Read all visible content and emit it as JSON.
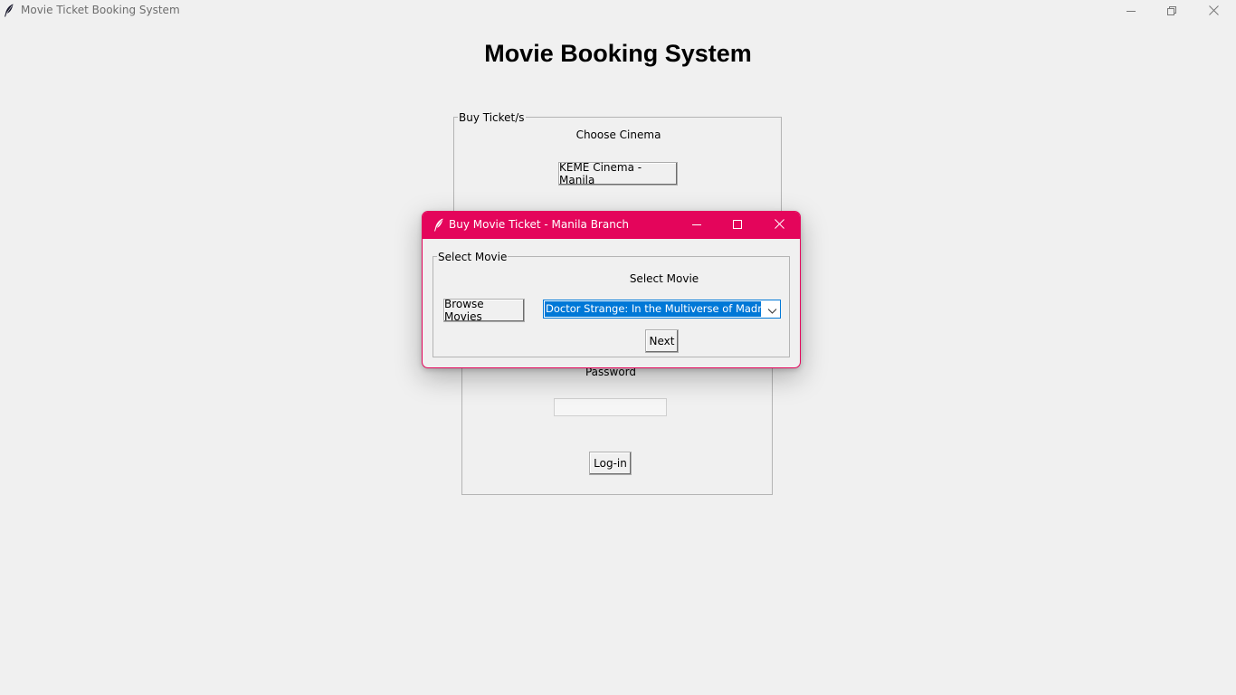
{
  "main_window": {
    "title": "Movie Ticket Booking System",
    "heading": "Movie Booking System"
  },
  "buy_frame": {
    "legend": "Buy Ticket/s",
    "choose_cinema_label": "Choose Cinema",
    "cinema_button_label": "KEME Cinema - Manila"
  },
  "login_frame": {
    "password_label": "Password",
    "password_value": "",
    "login_button_label": "Log-in"
  },
  "dialog": {
    "title": "Buy Movie Ticket - Manila Branch",
    "accent_color": "#e4055b",
    "select_frame_legend": "Select Movie",
    "select_movie_label": "Select Movie",
    "browse_button_label": "Browse Movies",
    "movie_selected": "Doctor Strange: In the Multiverse of Madness",
    "next_button_label": "Next"
  },
  "icons": {
    "app_icon": "feather-icon",
    "minimize": "minimize-icon",
    "maximize": "maximize-icon",
    "close": "close-icon",
    "dropdown": "chevron-down-icon"
  }
}
